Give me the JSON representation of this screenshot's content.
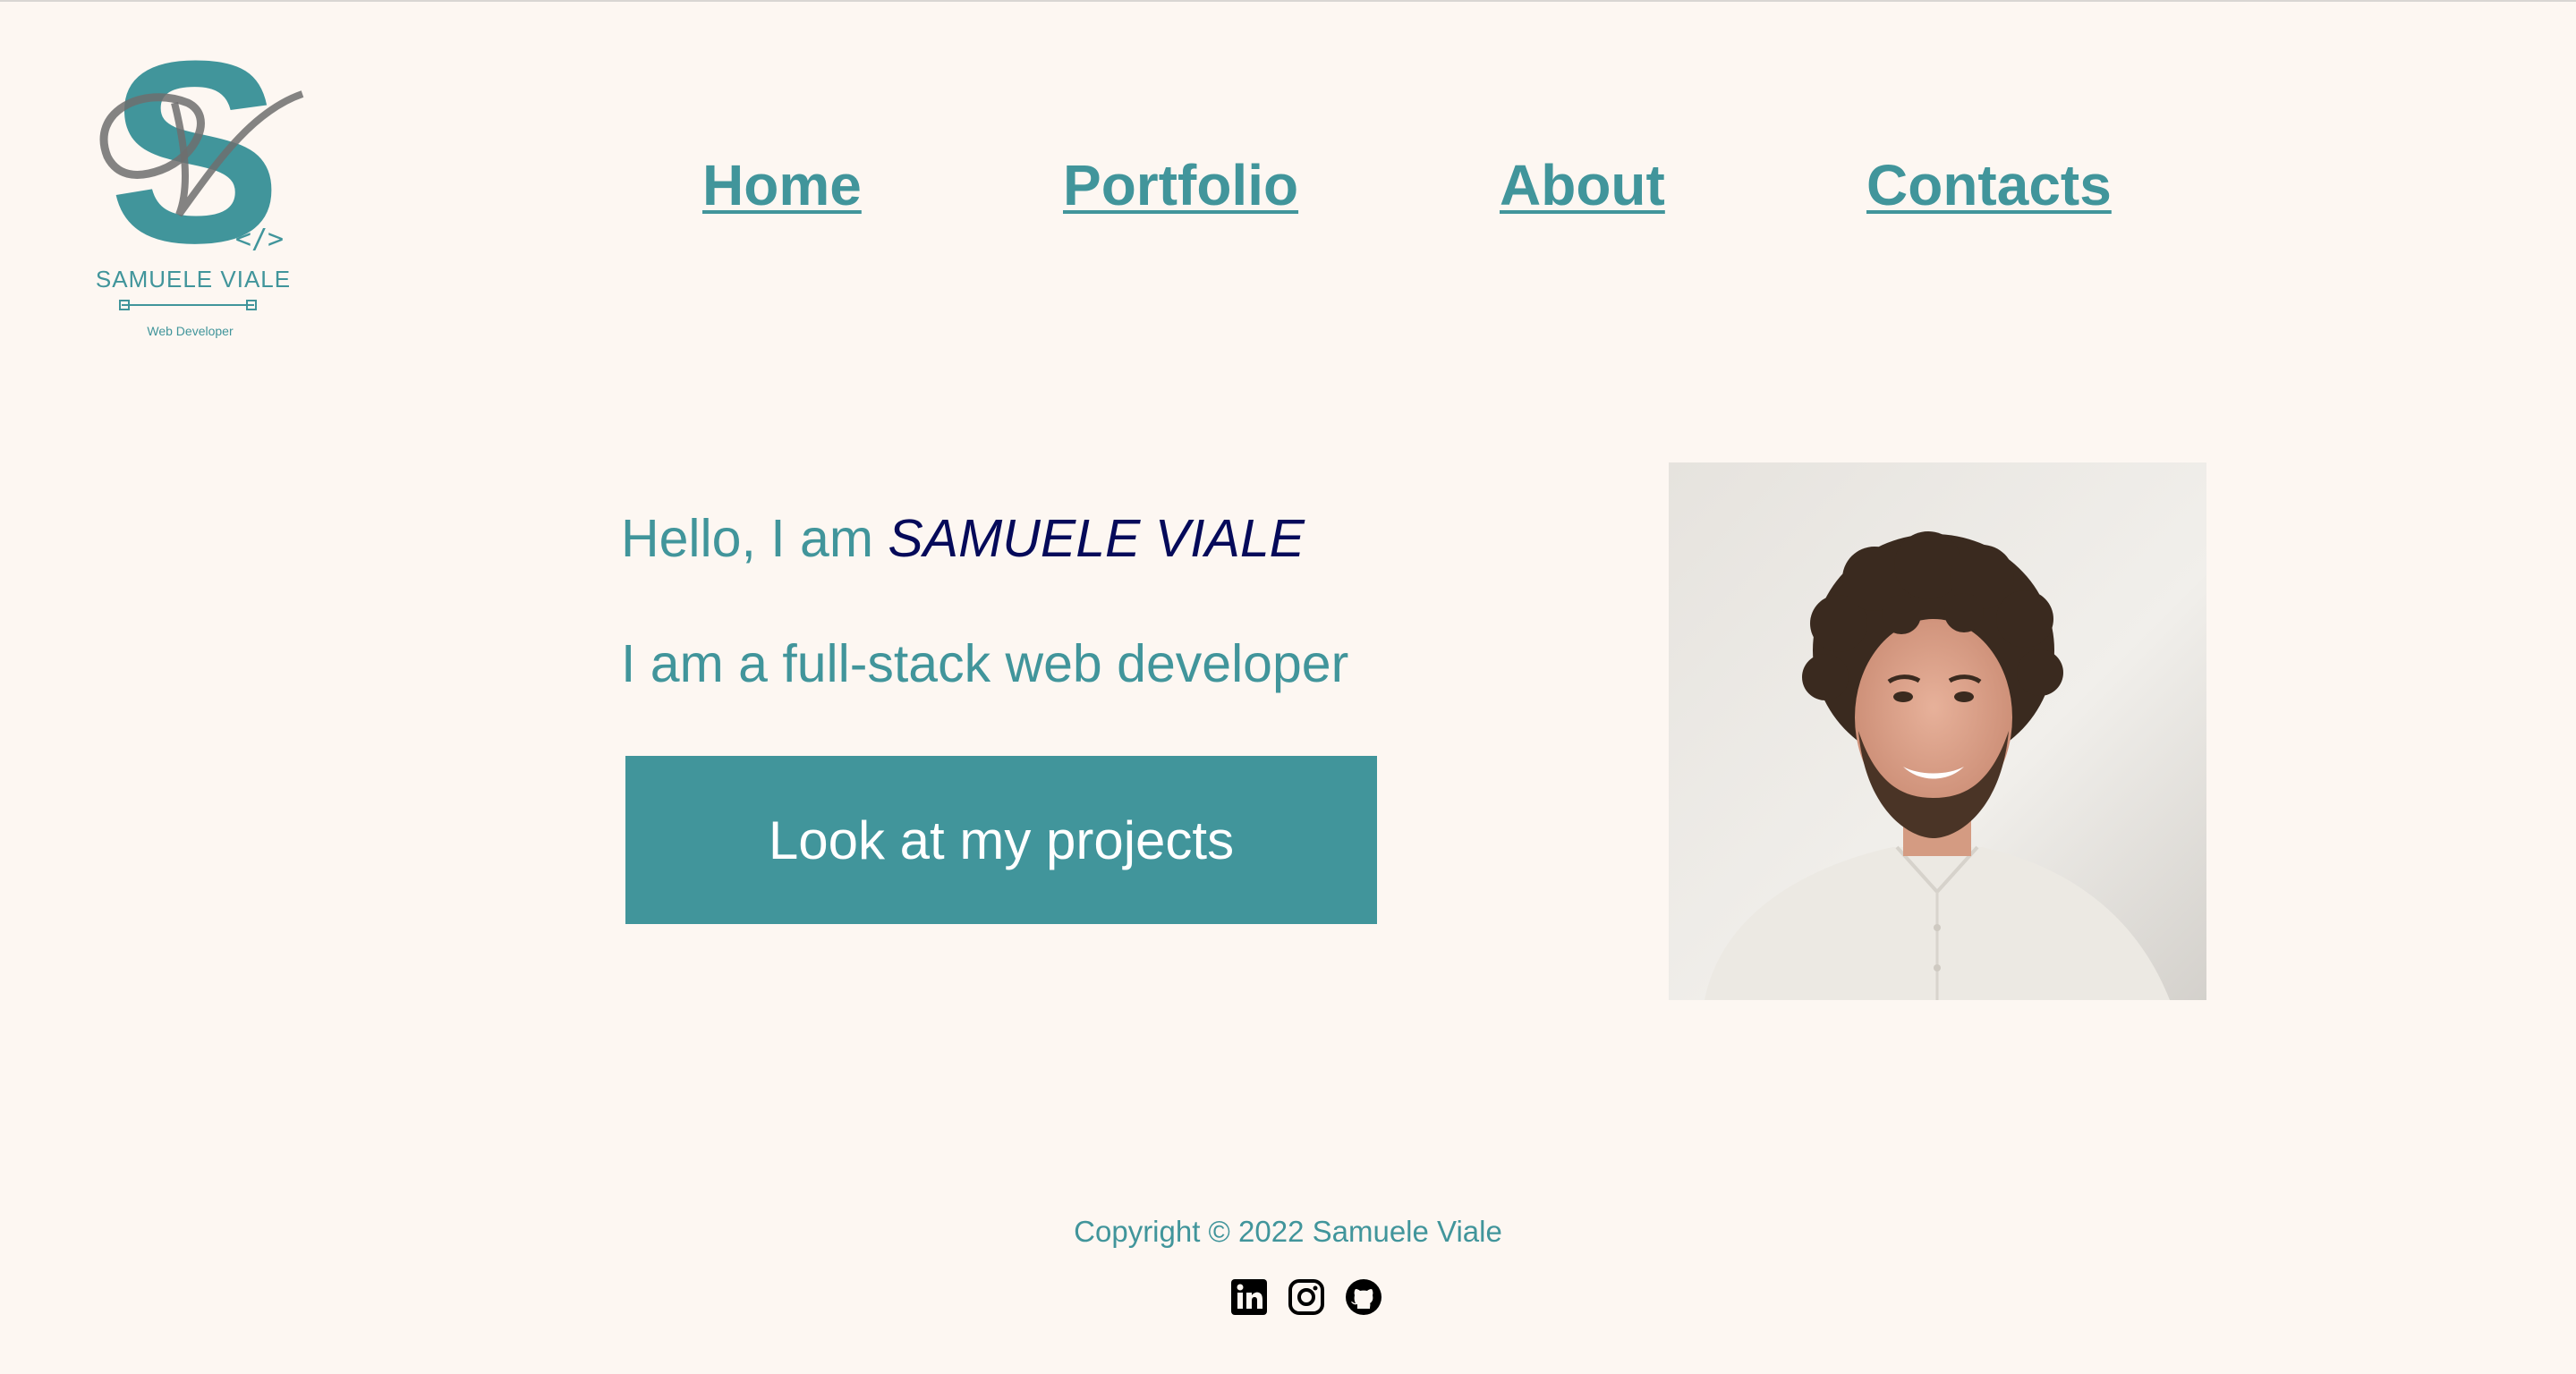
{
  "logo": {
    "monogram": "S",
    "script_letter": "V",
    "code_icon": "code-brackets-icon",
    "name": "SAMUELE VIALE",
    "subtitle": "Web Developer"
  },
  "nav": {
    "items": [
      {
        "label": "Home"
      },
      {
        "label": "Portfolio"
      },
      {
        "label": "About"
      },
      {
        "label": "Contacts"
      }
    ]
  },
  "hero": {
    "greeting_prefix": "Hello, I am ",
    "name": "SAMUELE VIALE",
    "tagline": "I am a full-stack web developer",
    "cta_label": "Look at my projects"
  },
  "footer": {
    "copyright": "Copyright © 2022 Samuele Viale",
    "social": [
      {
        "name": "linkedin-icon"
      },
      {
        "name": "instagram-icon"
      },
      {
        "name": "github-icon"
      }
    ]
  },
  "colors": {
    "background": "#fdf7f2",
    "accent": "#41959b",
    "name_highlight": "#050a5a",
    "button_text": "#ffffff"
  }
}
